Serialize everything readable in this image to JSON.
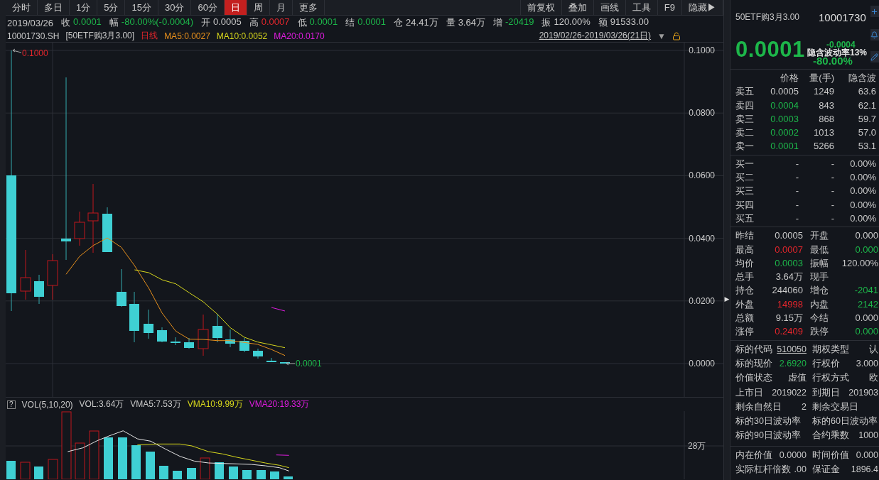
{
  "toolbar": {
    "periods": [
      {
        "label": "分时",
        "selected": false
      },
      {
        "label": "多日",
        "selected": false
      },
      {
        "label": "1分",
        "selected": false
      },
      {
        "label": "5分",
        "selected": false
      },
      {
        "label": "15分",
        "selected": false
      },
      {
        "label": "30分",
        "selected": false
      },
      {
        "label": "60分",
        "selected": false
      },
      {
        "label": "日",
        "selected": true
      },
      {
        "label": "周",
        "selected": false
      },
      {
        "label": "月",
        "selected": false
      },
      {
        "label": "更多",
        "selected": false
      }
    ],
    "tools": [
      "前复权",
      "叠加",
      "画线",
      "工具",
      "F9",
      "隐藏▶"
    ]
  },
  "quote_bar": {
    "date": "2019/03/26",
    "items": [
      {
        "label": "收",
        "value": "0.0001",
        "color": "#1db64a"
      },
      {
        "label": "幅",
        "value": "-80.00%(-0.0004)",
        "color": "#1db64a"
      },
      {
        "label": "开",
        "value": "0.0005",
        "color": "#c9c9c9"
      },
      {
        "label": "高",
        "value": "0.0007",
        "color": "#e5262c"
      },
      {
        "label": "低",
        "value": "0.0001",
        "color": "#1db64a"
      },
      {
        "label": "结",
        "value": "0.0001",
        "color": "#1db64a"
      },
      {
        "label": "仓",
        "value": "24.41万",
        "color": "#c9c9c9"
      },
      {
        "label": "量",
        "value": "3.64万",
        "color": "#c9c9c9"
      },
      {
        "label": "增",
        "value": "-20419",
        "color": "#1db64a"
      },
      {
        "label": "振",
        "value": "120.00%",
        "color": "#c9c9c9"
      },
      {
        "label": "额",
        "value": "91533.00",
        "color": "#c9c9c9"
      }
    ]
  },
  "chart_header": {
    "code": "10001730.SH",
    "name": "[50ETF购3月3.00]",
    "indicators": [
      {
        "text": "日线",
        "color": "#e5262c"
      },
      {
        "text": "MA5:0.0027",
        "color": "#e8901c"
      },
      {
        "text": "MA10:0.0052",
        "color": "#d8d81c"
      },
      {
        "text": "MA20:0.0170",
        "color": "#e01ce0"
      }
    ],
    "date_range": "2019/02/26-2019/03/26(21日)",
    "range_menu": "▼"
  },
  "price_chart": {
    "axis_labels": [
      "0.1000",
      "0.0800",
      "0.0600",
      "0.0400",
      "0.0200",
      "0.0000"
    ],
    "high_label": "0.1000",
    "last_label": "0.0001"
  },
  "volume_chart": {
    "help": "?",
    "indicators": [
      {
        "text": "VOL(5,10,20)",
        "color": "#c9c9c9"
      },
      {
        "text": "VOL:3.64万",
        "color": "#c9c9c9"
      },
      {
        "text": "VMA5:7.53万",
        "color": "#c9c9c9"
      },
      {
        "text": "VMA10:9.99万",
        "color": "#d8d81c"
      },
      {
        "text": "VMA20:19.33万",
        "color": "#e01ce0"
      }
    ],
    "axis_label": "28万"
  },
  "side_toggle": "▶",
  "quote_panel": {
    "name": "50ETF购3月3.00",
    "code": "10001730",
    "price": "0.0001",
    "change": "-0.0004",
    "implied_vol": "隐含波动率13%",
    "change_pct": "-80.00%",
    "order_book": {
      "columns": [
        "价格",
        "量(手)",
        "隐含波"
      ],
      "asks": [
        {
          "label": "卖五",
          "price": "0.0005",
          "volume": "1249",
          "iv": "63.6",
          "color": "#c9c9c9"
        },
        {
          "label": "卖四",
          "price": "0.0004",
          "volume": "843",
          "iv": "62.1",
          "color": "#1db64a"
        },
        {
          "label": "卖三",
          "price": "0.0003",
          "volume": "868",
          "iv": "59.7",
          "color": "#1db64a"
        },
        {
          "label": "卖二",
          "price": "0.0002",
          "volume": "1013",
          "iv": "57.0",
          "color": "#1db64a"
        },
        {
          "label": "卖一",
          "price": "0.0001",
          "volume": "5266",
          "iv": "53.1",
          "color": "#1db64a"
        }
      ],
      "bids": [
        {
          "label": "买一",
          "price": "-",
          "volume": "-",
          "iv": "0.00%"
        },
        {
          "label": "买二",
          "price": "-",
          "volume": "-",
          "iv": "0.00%"
        },
        {
          "label": "买三",
          "price": "-",
          "volume": "-",
          "iv": "0.00%"
        },
        {
          "label": "买四",
          "price": "-",
          "volume": "-",
          "iv": "0.00%"
        },
        {
          "label": "买五",
          "price": "-",
          "volume": "-",
          "iv": "0.00%"
        }
      ]
    },
    "stats": [
      {
        "label": "昨结",
        "value": "0.0005",
        "color": "#c9c9c9"
      },
      {
        "label": "开盘",
        "value": "0.000",
        "color": "#c9c9c9"
      },
      {
        "label": "最高",
        "value": "0.0007",
        "color": "#e5262c"
      },
      {
        "label": "最低",
        "value": "0.000",
        "color": "#1db64a"
      },
      {
        "label": "均价",
        "value": "0.0003",
        "color": "#1db64a"
      },
      {
        "label": "振幅",
        "value": "120.00%",
        "color": "#c9c9c9"
      },
      {
        "label": "总手",
        "value": "3.64万",
        "color": "#c9c9c9"
      },
      {
        "label": "现手"
      },
      {
        "label": "持仓",
        "value": "244060",
        "color": "#c9c9c9"
      },
      {
        "label": "增仓",
        "value": "-2041",
        "color": "#1db64a"
      },
      {
        "label": "外盘",
        "value": "14998",
        "color": "#e5262c"
      },
      {
        "label": "内盘",
        "value": "2142",
        "color": "#1db64a"
      },
      {
        "label": "总额",
        "value": "9.15万",
        "color": "#c9c9c9"
      },
      {
        "label": "今结",
        "value": "0.000",
        "color": "#c9c9c9"
      },
      {
        "label": "涨停",
        "value": "0.2409",
        "color": "#e5262c"
      },
      {
        "label": "跌停",
        "value": "0.000",
        "color": "#1db64a"
      }
    ],
    "details": [
      {
        "label": "标的代码",
        "value": "510050",
        "kind": "link"
      },
      {
        "label": "期权类型",
        "value": "认",
        "kind": "plain"
      },
      {
        "label": "标的现价",
        "value": "2.6920",
        "kind": "plain",
        "color": "#1db64a"
      },
      {
        "label": "行权价",
        "value": "3.000",
        "kind": "plain"
      },
      {
        "label": "价值状态",
        "value": "虚值",
        "kind": "plain"
      },
      {
        "label": "行权方式",
        "value": "欧",
        "kind": "plain"
      },
      {
        "label": "上市日",
        "value": "2019022",
        "kind": "plain"
      },
      {
        "label": "到期日",
        "value": "201903",
        "kind": "plain"
      },
      {
        "label": "剩余自然日",
        "value": "2",
        "kind": "plain"
      },
      {
        "label": "剩余交易日"
      },
      {
        "label": "标的30日波动率"
      },
      {
        "label": "标的60日波动率"
      },
      {
        "label": "标的90日波动率"
      },
      {
        "label": "合约乘数",
        "value": "1000",
        "kind": "plain"
      }
    ],
    "values": [
      {
        "label": "内在价值",
        "value": "0.0000"
      },
      {
        "label": "时间价值",
        "value": "0.000"
      },
      {
        "label": "实际杠杆倍数",
        "value": ".00"
      },
      {
        "label": "保证金",
        "value": "1896.4"
      }
    ]
  }
}
